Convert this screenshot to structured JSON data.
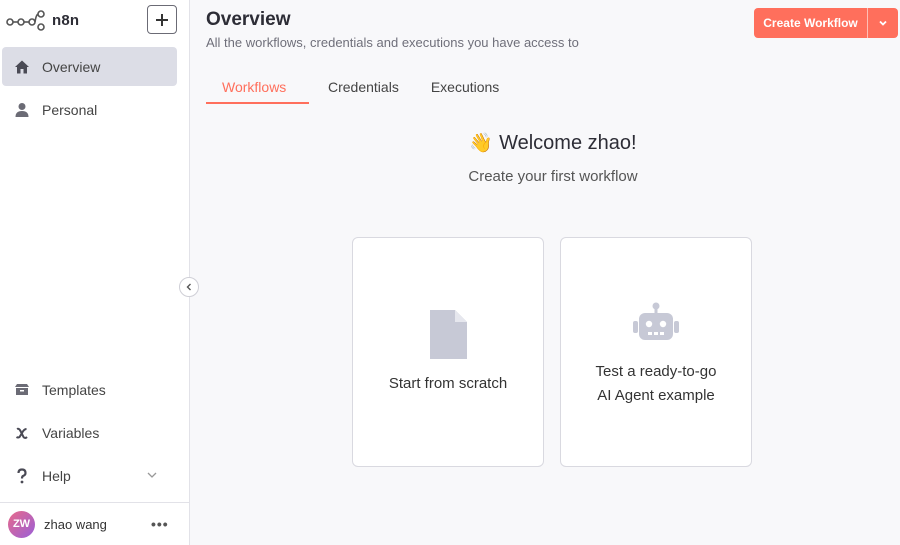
{
  "app": {
    "logo_text": "n8n",
    "brand_color": "#ff6f5c"
  },
  "sidebar": {
    "items": [
      {
        "label": "Overview",
        "icon": "home-icon",
        "active": true
      },
      {
        "label": "Personal",
        "icon": "user-icon",
        "active": false
      }
    ],
    "bottom_items": [
      {
        "label": "Templates",
        "icon": "templates-box-icon"
      },
      {
        "label": "Variables",
        "icon": "variable-x-icon"
      },
      {
        "label": "Help",
        "icon": "question-icon"
      }
    ],
    "user": {
      "initials": "ZW",
      "name": "zhao wang"
    }
  },
  "header": {
    "title": "Overview",
    "subtitle": "All the workflows, credentials and executions you have access to",
    "create_button_label": "Create Workflow"
  },
  "tabs": [
    {
      "label": "Workflows",
      "active": true
    },
    {
      "label": "Credentials",
      "active": false
    },
    {
      "label": "Executions",
      "active": false
    }
  ],
  "welcome": {
    "emoji": "👋",
    "title": "Welcome zhao!",
    "subtitle": "Create your first workflow"
  },
  "cards": [
    {
      "label": "Start from scratch",
      "icon": "file-icon"
    },
    {
      "label_line1": "Test a ready-to-go",
      "label_line2": "AI Agent example",
      "icon": "robot-icon"
    }
  ]
}
